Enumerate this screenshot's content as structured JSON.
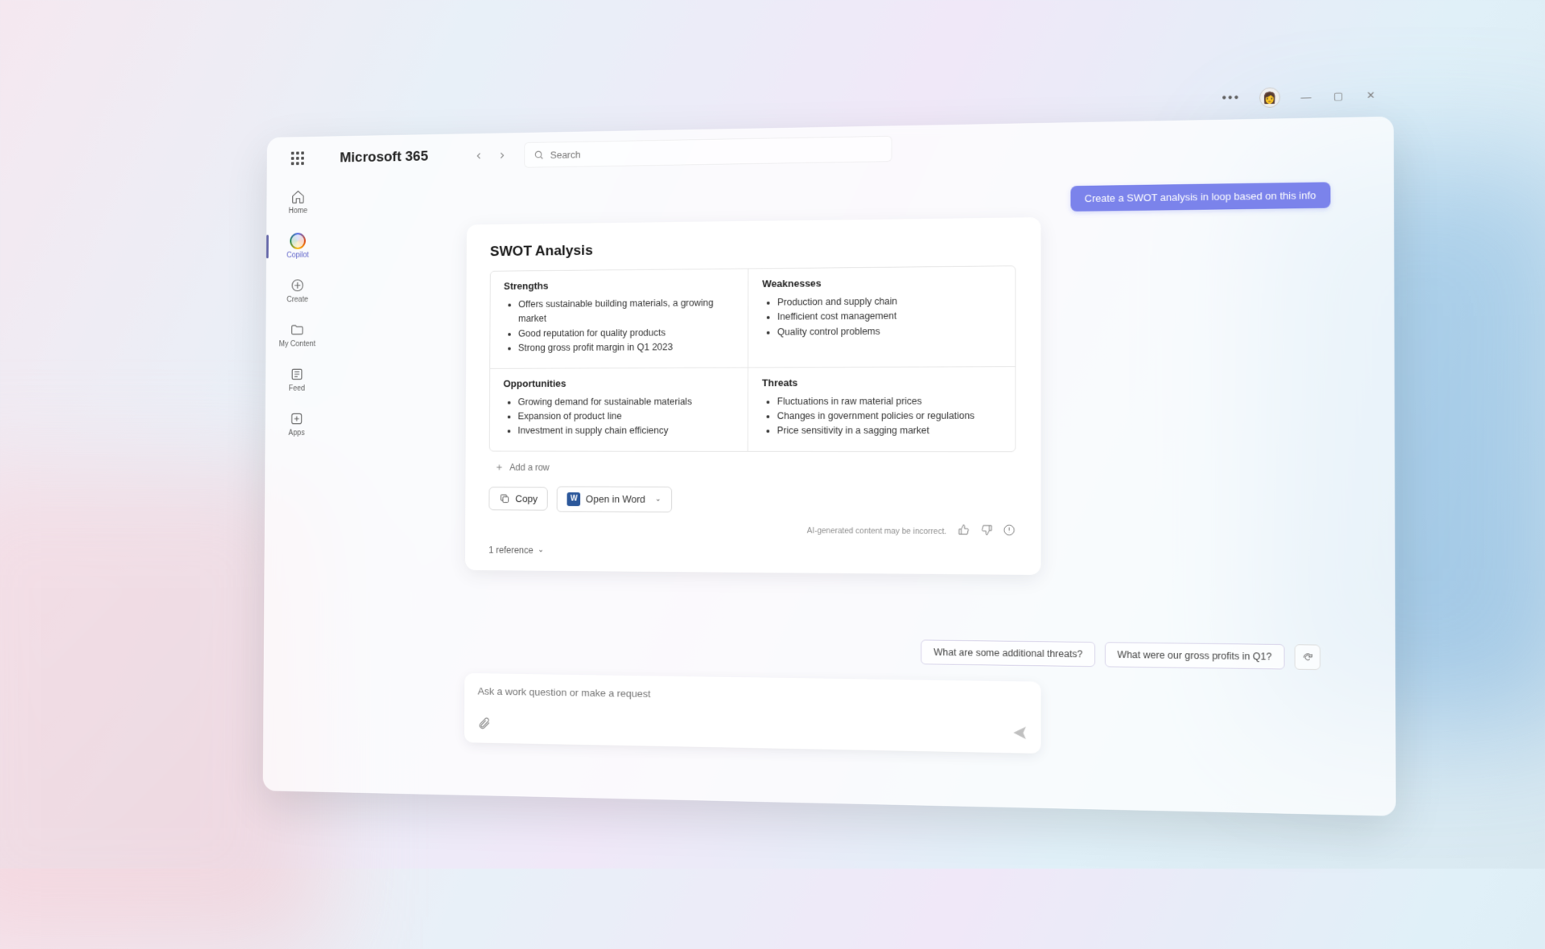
{
  "window": {
    "title": "Microsoft 365",
    "search_placeholder": "Search"
  },
  "rail": {
    "items": [
      {
        "label": "Home"
      },
      {
        "label": "Copilot"
      },
      {
        "label": "Create"
      },
      {
        "label": "My Content"
      },
      {
        "label": "Feed"
      },
      {
        "label": "Apps"
      }
    ]
  },
  "chat": {
    "user_message": "Create a SWOT analysis in loop based on this info",
    "card_title": "SWOT Analysis",
    "swot": {
      "strengths": {
        "heading": "Strengths",
        "items": [
          "Offers sustainable building materials, a growing market",
          "Good reputation for quality products",
          "Strong gross profit margin in Q1 2023"
        ]
      },
      "weaknesses": {
        "heading": "Weaknesses",
        "items": [
          "Production and supply chain",
          "Inefficient cost management",
          "Quality control problems"
        ]
      },
      "opportunities": {
        "heading": "Opportunities",
        "items": [
          "Growing demand for sustainable materials",
          "Expansion of product line",
          "Investment in supply chain efficiency"
        ]
      },
      "threats": {
        "heading": "Threats",
        "items": [
          "Fluctuations in raw material prices",
          "Changes in government policies or regulations",
          "Price sensitivity in a sagging market"
        ]
      }
    },
    "add_row": "Add a row",
    "copy": "Copy",
    "open_in_word": "Open in Word",
    "disclaimer": "AI-generated content may be incorrect.",
    "references": "1 reference",
    "suggestions": [
      "What are some additional threats?",
      "What were our gross profits in Q1?"
    ],
    "compose_placeholder": "Ask a work question or make a request"
  }
}
